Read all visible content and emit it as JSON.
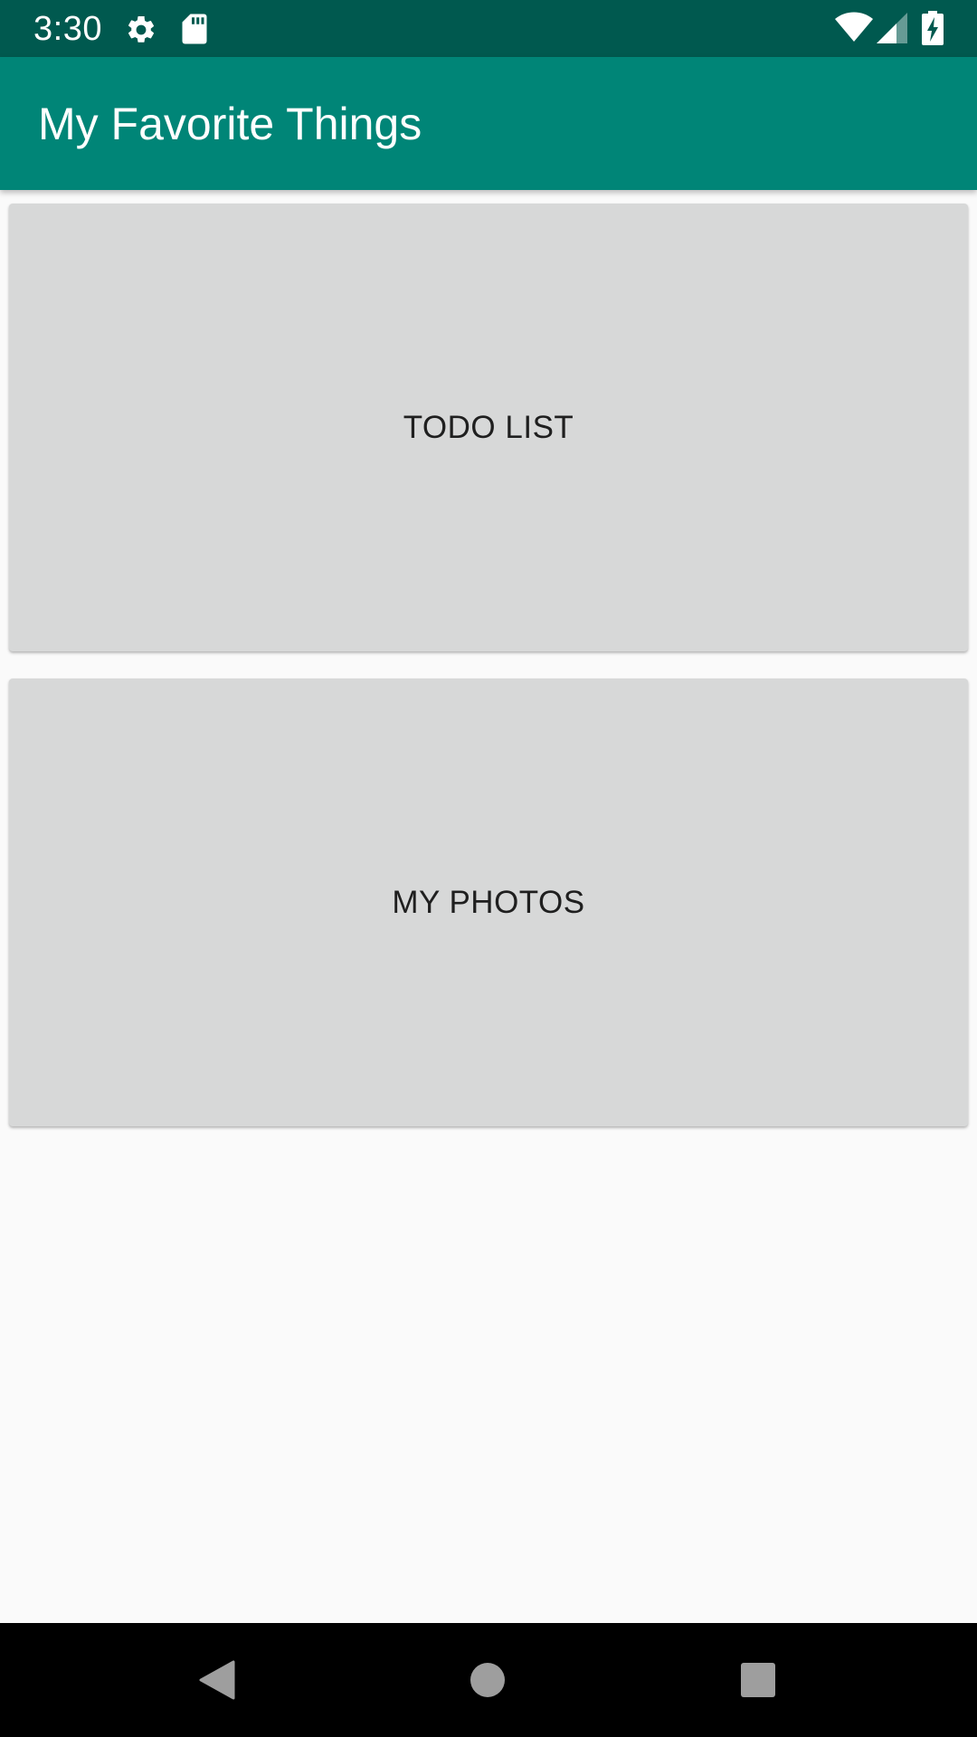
{
  "status_bar": {
    "time": "3:30",
    "icons": [
      "gear-icon",
      "sd-card-icon",
      "wifi-icon",
      "signal-icon",
      "battery-charging-icon"
    ],
    "color": "#00594f"
  },
  "app_bar": {
    "title": "My Favorite Things",
    "color": "#008577"
  },
  "buttons": {
    "todo_label": "TODO LIST",
    "photos_label": "MY PHOTOS",
    "color": "#d7d8d8"
  },
  "nav_bar": {
    "icons": [
      "back-icon",
      "home-icon",
      "recents-icon"
    ]
  }
}
